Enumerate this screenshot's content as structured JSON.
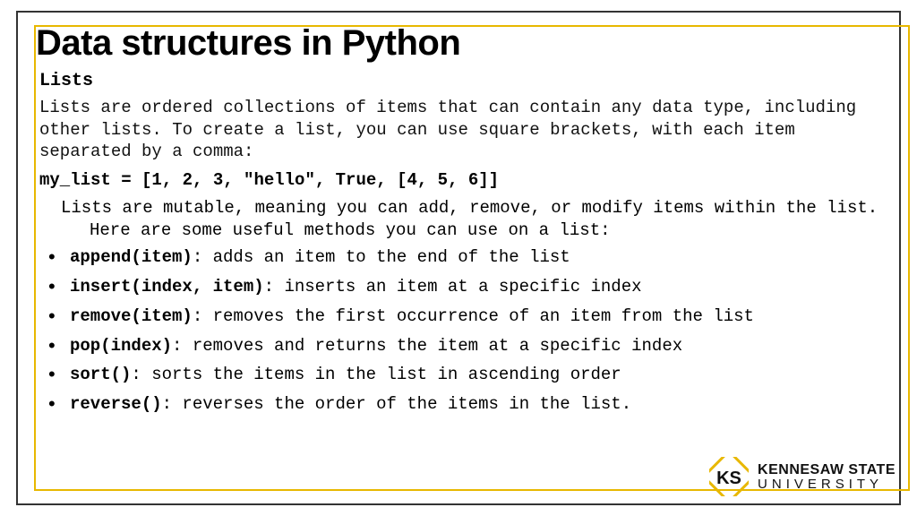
{
  "title": "Data structures in Python",
  "section_title": "Lists",
  "intro": "Lists are ordered collections of items that can contain any data type, including other lists. To create a list, you can use square brackets, with each item separated by a comma:",
  "code_example": "my_list = [1, 2, 3, \"hello\", True, [4, 5, 6]]",
  "mutable_text": "Lists are mutable, meaning you can add, remove, or modify items within the list. Here are some useful methods you can use on a list:",
  "methods": [
    {
      "name": "append(item)",
      "desc": ": adds an item to the end of the list"
    },
    {
      "name": "insert(index, item)",
      "desc": ": inserts an item at a specific index"
    },
    {
      "name": "remove(item)",
      "desc": ": removes the first occurrence of an item from the list"
    },
    {
      "name": "pop(index)",
      "desc": ": removes and returns the item at a specific index"
    },
    {
      "name": "sort()",
      "desc": ": sorts the items in the list in ascending order"
    },
    {
      "name": "reverse()",
      "desc": ": reverses the order of the items in the list."
    }
  ],
  "logo": {
    "line1": "KENNESAW STATE",
    "line2": "UNIVERSITY"
  }
}
